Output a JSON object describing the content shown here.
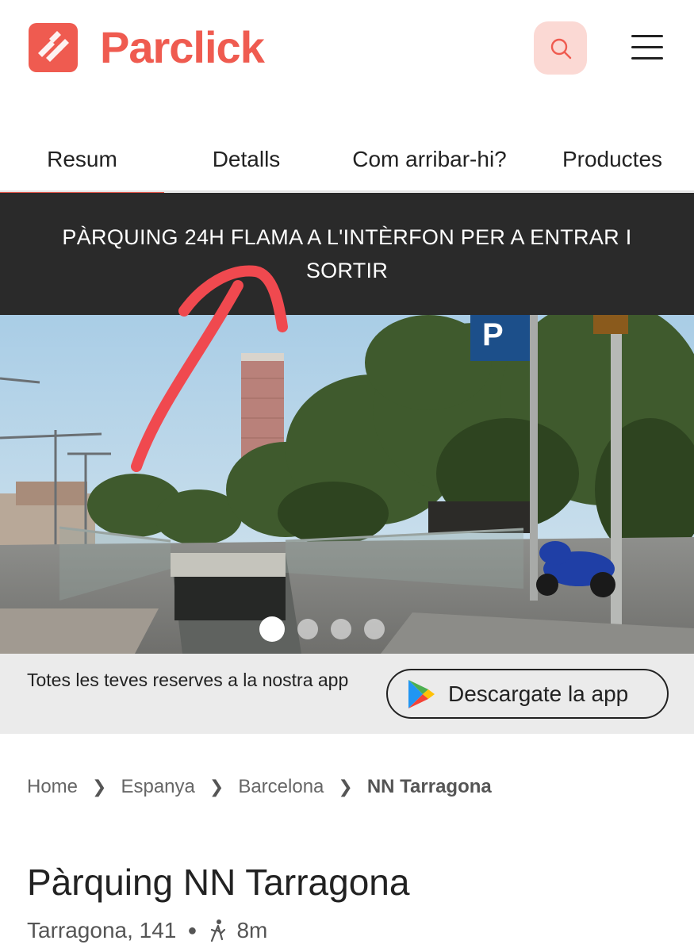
{
  "header": {
    "brand": "Parclick",
    "search_icon": "search-icon",
    "menu_icon": "hamburger-menu-icon",
    "accent_color": "#ef5b50"
  },
  "tabs": [
    {
      "label": "Resum",
      "active": true
    },
    {
      "label": "Detalls",
      "active": false
    },
    {
      "label": "Com arribar-hi?",
      "active": false
    },
    {
      "label": "Productes",
      "active": false
    }
  ],
  "notice": {
    "text": "PÀRQUING 24H FLAMA A L'INTÈRFON PER A ENTRAR I SORTIR"
  },
  "gallery": {
    "image_count": 4,
    "active_index": 0
  },
  "app_banner": {
    "text": "Totes les teves reserves a la nostra app",
    "button_label": "Descargate la app",
    "button_icon": "google-play-icon"
  },
  "breadcrumb": [
    "Home",
    "Espanya",
    "Barcelona",
    "NN Tarragona"
  ],
  "parking": {
    "title": "Pàrquing NN Tarragona",
    "address": "Tarragona, 141",
    "walk_icon": "walking-icon",
    "walk_time": "8m"
  }
}
